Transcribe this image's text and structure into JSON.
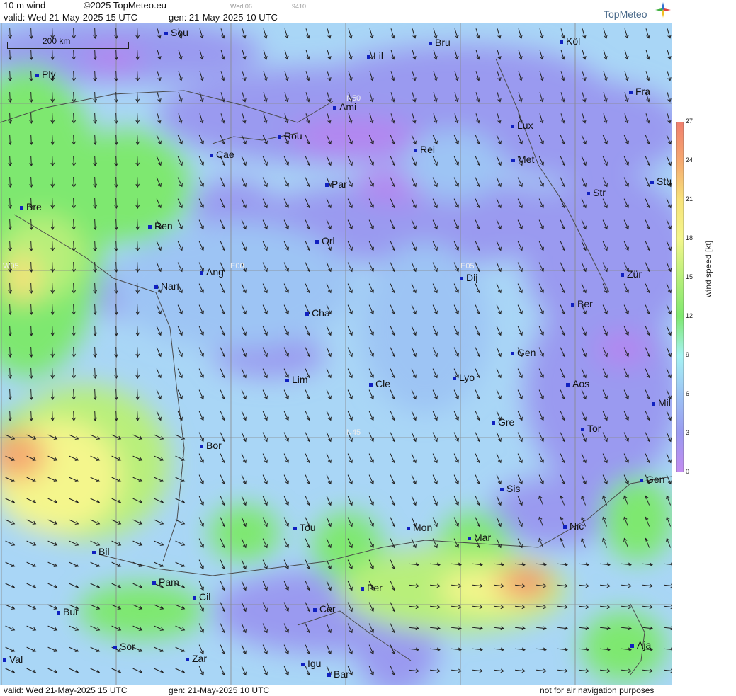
{
  "header": {
    "product": "10 m wind",
    "copyright": "©2025 TopMeteo.eu",
    "day_code": "Wed 06",
    "id_code": "9410",
    "valid": "valid:  Wed  21-May-2025  15 UTC",
    "gen": "gen: 21-May-2025 10 UTC",
    "logo": "TopMeteo"
  },
  "footer": {
    "valid": "valid:  Wed  21-May-2025  15 UTC",
    "gen": "gen: 21-May-2025 10 UTC",
    "disclaimer": "not for air navigation purposes"
  },
  "legend": {
    "title": "wind  speed  [kt]",
    "ticks": [
      "27",
      "24",
      "21",
      "18",
      "15",
      "12",
      "9",
      "6",
      "3",
      "0"
    ],
    "colors": [
      "#f07f6e",
      "#f5a870",
      "#f7e27a",
      "#f4f68c",
      "#b8ef7a",
      "#7ee86f",
      "#a6f3f3",
      "#9dc4f4",
      "#9a9af0",
      "#c38cf0"
    ]
  },
  "map": {
    "scale_label": "200 km",
    "grid_labels": [
      "N50",
      "N45",
      "E00",
      "E05",
      "W05"
    ],
    "cities": [
      "Sou",
      "Lil",
      "Bru",
      "Köl",
      "Ply",
      "Ami",
      "Fra",
      "Rou",
      "Lux",
      "Cae",
      "Rei",
      "Met",
      "Par",
      "Stu",
      "Str",
      "Bre",
      "Ren",
      "Orl",
      "Ang",
      "Dij",
      "Zür",
      "Nan",
      "Cha",
      "Ber",
      "Gen",
      "Lim",
      "Cle",
      "Lyo",
      "Aos",
      "Mil",
      "Gre",
      "Tor",
      "Bor",
      "Sis",
      "Gen",
      "Nic",
      "Tou",
      "Mon",
      "Mar",
      "Bil",
      "Pam",
      "Cil",
      "Per",
      "Bur",
      "Cer",
      "Sor",
      "Aja",
      "Val",
      "Zar",
      "Igu",
      "Bar"
    ]
  }
}
